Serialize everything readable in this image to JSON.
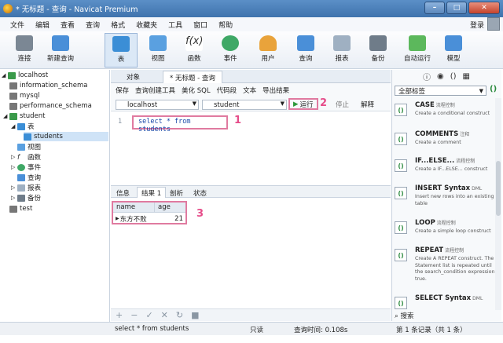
{
  "window": {
    "title": "* 无标题 - 查询 - Navicat Premium"
  },
  "menu": [
    "文件",
    "编辑",
    "查看",
    "查询",
    "格式",
    "收藏夹",
    "工具",
    "窗口",
    "帮助"
  ],
  "login": "登录",
  "toolbar": [
    "连接",
    "新建查询",
    "表",
    "视图",
    "函数",
    "事件",
    "用户",
    "查询",
    "报表",
    "备份",
    "自动运行",
    "模型"
  ],
  "tree": {
    "conn": "localhost",
    "dbs": [
      "information_schema",
      "mysql",
      "performance_schema",
      "student"
    ],
    "tables_label": "表",
    "table": "students",
    "nodes": [
      "视图",
      "函数",
      "事件",
      "查询",
      "报表",
      "备份"
    ],
    "other_db": "test"
  },
  "tabs": [
    "对象",
    "* 无标题 - 查询"
  ],
  "query_toolbar": [
    "保存",
    "查询创建工具",
    "美化 SQL",
    "代码段",
    "文本",
    "导出结果"
  ],
  "connection": "localhost",
  "database": "student",
  "run": "运行",
  "stop": "停止",
  "explain": "解释",
  "editor": {
    "line": "1",
    "sql": "select * from students"
  },
  "markers": [
    "1",
    "2",
    "3"
  ],
  "result_tabs": [
    "信息",
    "结果 1",
    "剖析",
    "状态"
  ],
  "result": {
    "columns": [
      "name",
      "age"
    ],
    "rows": [
      [
        "东方不败",
        "21"
      ]
    ]
  },
  "status": {
    "sql": "select * from students",
    "mode": "只读",
    "time": "查询时间: 0.108s",
    "records": "第 1 条记录（共 1 条）"
  },
  "right_panel": {
    "select": "全部标签",
    "snippets": [
      {
        "title": "CASE",
        "tag": "流程控制",
        "desc": "Create a conditional construct"
      },
      {
        "title": "COMMENTS",
        "tag": "注释",
        "desc": "Create a comment"
      },
      {
        "title": "IF...ELSE...",
        "tag": "流程控制",
        "desc": "Create a IF...ELSE... construct"
      },
      {
        "title": "INSERT Syntax",
        "tag": "DML",
        "desc": "Insert new rows into an existing table"
      },
      {
        "title": "LOOP",
        "tag": "流程控制",
        "desc": "Create a simple loop construct"
      },
      {
        "title": "REPEAT",
        "tag": "流程控制",
        "desc": "Create A REPEAT construct. The Statement list is repeated until the search_condition expression is true."
      },
      {
        "title": "SELECT Syntax",
        "tag": "DML",
        "desc": ""
      }
    ],
    "search": "搜索"
  }
}
